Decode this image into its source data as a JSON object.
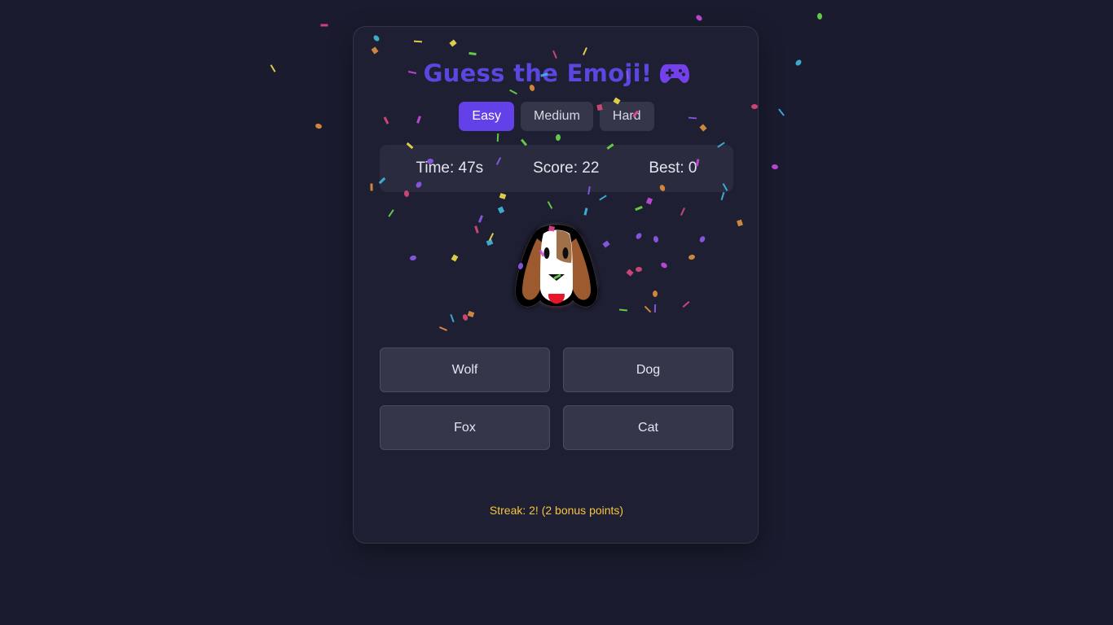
{
  "game": {
    "title": "Guess the Emoji!",
    "title_icon": "game-controller-icon",
    "difficulty": {
      "options": [
        "Easy",
        "Medium",
        "Hard"
      ],
      "selected": "Easy"
    },
    "stats": {
      "time": "Time: 47s",
      "score": "Score: 22",
      "best": "Best: 0"
    },
    "emoji": "dog-face-emoji",
    "answers": [
      "Wolf",
      "Dog",
      "Fox",
      "Cat"
    ],
    "streak": "Streak: 2! (2 bonus points)"
  },
  "colors": {
    "background": "#1a1b2e",
    "card": "#1e1f33",
    "accent": "#6440e8",
    "title": "#5b46e0",
    "streak": "#f5c542",
    "confetti": [
      "#e84393",
      "#3fb8e0",
      "#f0e04a",
      "#8e5bf0",
      "#e0913f",
      "#6ad94a",
      "#d94a7a",
      "#c94ae0"
    ]
  }
}
